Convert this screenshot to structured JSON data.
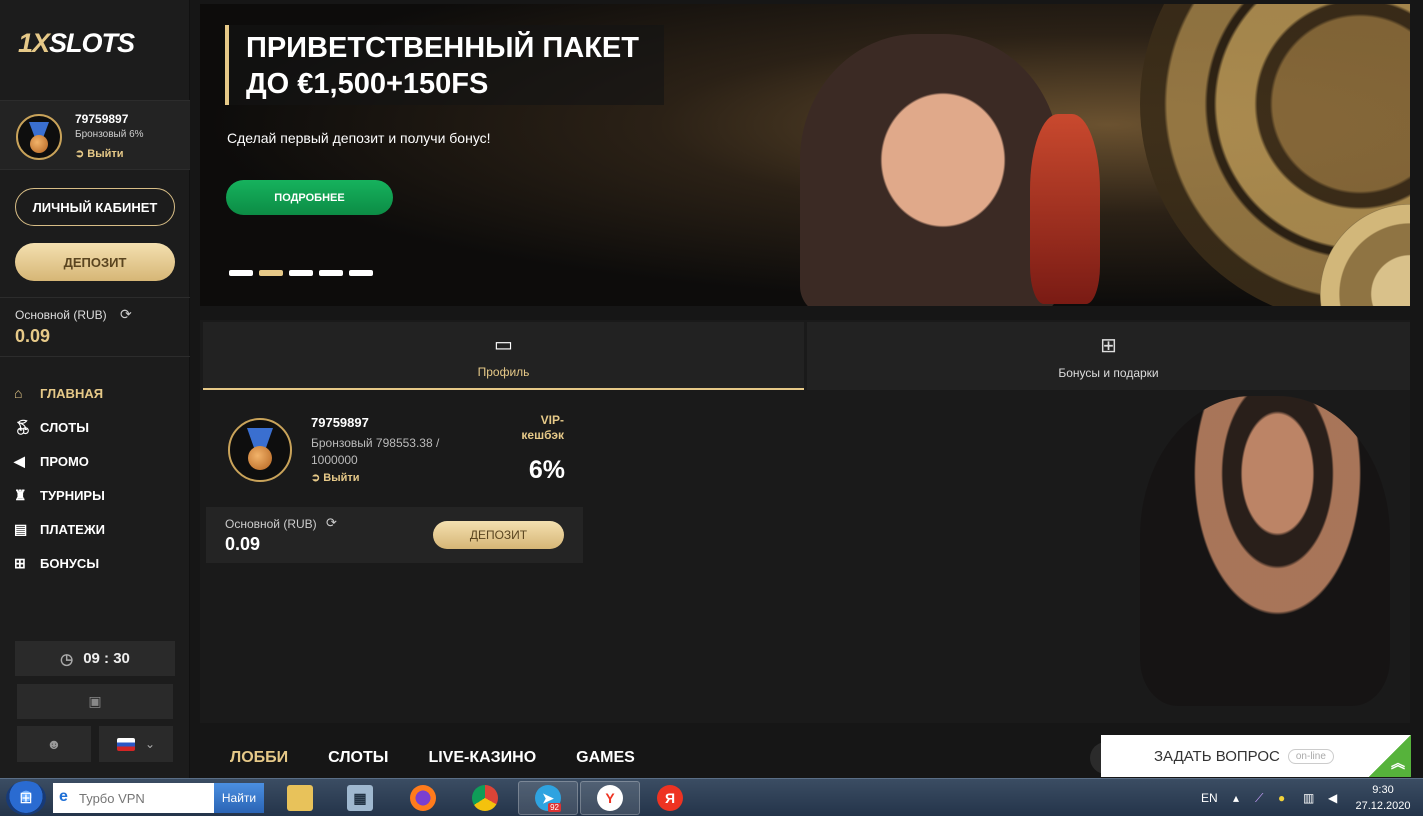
{
  "brand": {
    "logo_prefix": "1X",
    "logo_suffix": "SLOTS"
  },
  "user": {
    "id": "79759897",
    "level_short": "Бронзовый 6%",
    "logout_label": "Выйти",
    "level_full": "Бронзовый 798553.38 / 1000000"
  },
  "sidebar": {
    "cabinet_label": "ЛИЧНЫЙ КАБИНЕТ",
    "deposit_label": "ДЕПОЗИТ",
    "balance_label": "Основной (RUB)",
    "balance_value": "0.09",
    "nav": [
      {
        "label": "ГЛАВНАЯ",
        "icon": "home-icon"
      },
      {
        "label": "СЛОТЫ",
        "icon": "cherries-icon"
      },
      {
        "label": "ПРОМО",
        "icon": "megaphone-icon"
      },
      {
        "label": "ТУРНИРЫ",
        "icon": "trophy-icon"
      },
      {
        "label": "ПЛАТЕЖИ",
        "icon": "wallet-icon"
      },
      {
        "label": "БОНУСЫ",
        "icon": "gift-icon"
      }
    ],
    "clock_hours": "09",
    "clock_sep": ":",
    "clock_minutes": "30"
  },
  "banner": {
    "title_line1": "ПРИВЕТСТВЕННЫЙ ПАКЕТ",
    "title_line2": "ДО €1,500+150FS",
    "subtitle": "Сделай первый депозит и получи бонус!",
    "cta_label": "ПОДРОБНЕЕ",
    "slide_count": 5,
    "active_slide": 2
  },
  "profile": {
    "tabs": [
      {
        "label": "Профиль",
        "icon": "id-card-icon"
      },
      {
        "label": "Бонусы и подарки",
        "icon": "gift-icon"
      }
    ],
    "vip_label_line1": "VIP-",
    "vip_label_line2": "кешбэк",
    "vip_value": "6%",
    "balance_label": "Основной (RUB)",
    "balance_value": "0.09",
    "deposit_label": "ДЕПОЗИТ"
  },
  "bottom_nav": [
    "ЛОББИ",
    "СЛОТЫ",
    "LIVE-КАЗИНО",
    "GAMES"
  ],
  "chat": {
    "label": "ЗАДАТЬ ВОПРОС",
    "status": "on-line"
  },
  "taskbar": {
    "search_placeholder": "Турбо VPN",
    "search_button": "Найти",
    "yandex_badge": "92",
    "lang": "EN",
    "time": "9:30",
    "date": "27.12.2020"
  },
  "colors": {
    "accent_gold": "#e6c988",
    "green_cta": "#16b25d",
    "background": "#161616"
  }
}
